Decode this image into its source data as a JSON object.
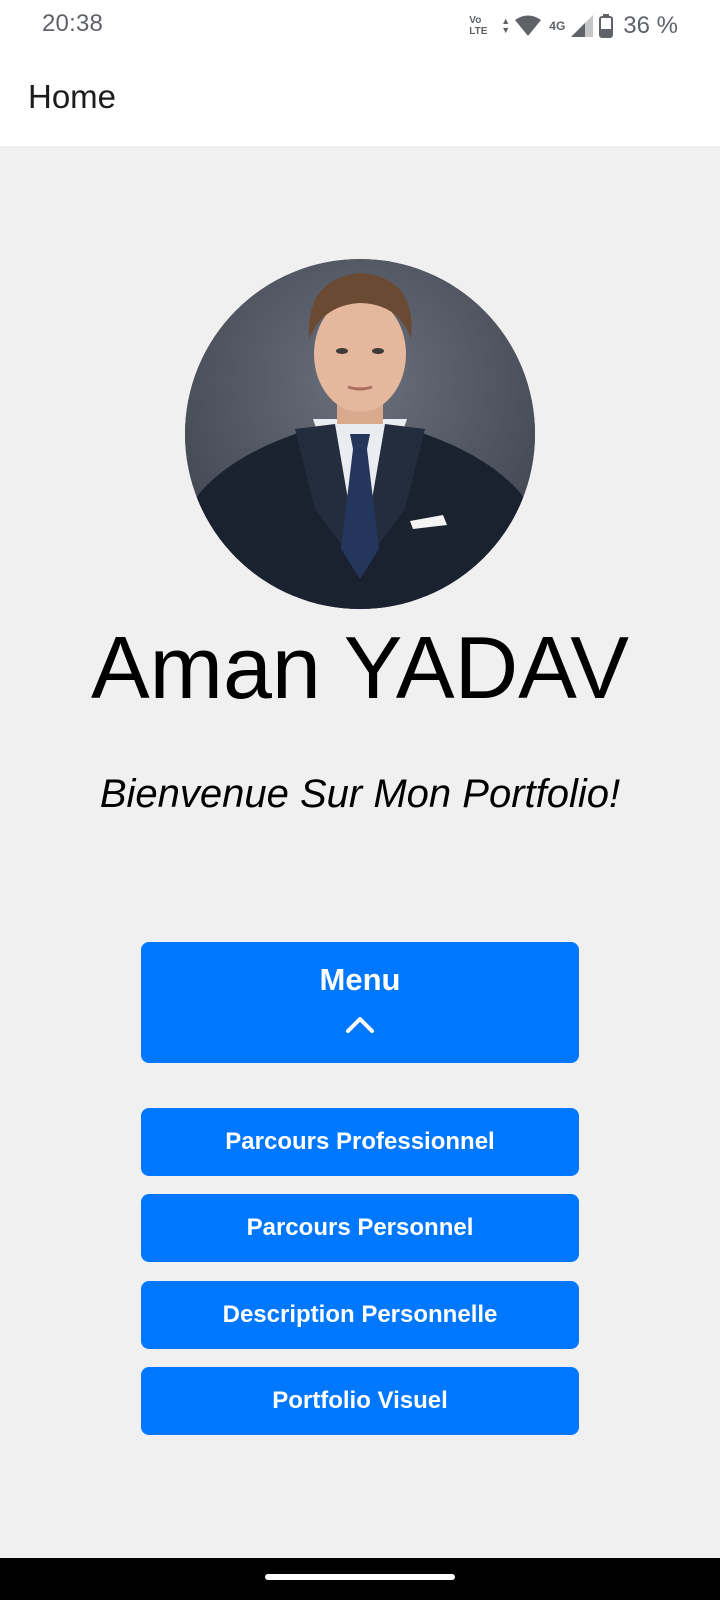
{
  "status_bar": {
    "time": "20:38",
    "volte_line1": "Vo",
    "volte_line2": "LTE",
    "network": "4G",
    "battery_percent": "36 %",
    "icons": [
      "volte-icon",
      "data-arrows-icon",
      "wifi-icon",
      "signal-icon",
      "battery-icon"
    ]
  },
  "app_bar": {
    "title": "Home"
  },
  "profile": {
    "avatar": "profile-photo",
    "name": "Aman YADAV",
    "tagline": "Bienvenue Sur Mon Portfolio!"
  },
  "menu": {
    "label": "Menu",
    "icon": "chevron-up-icon",
    "items": [
      {
        "label": "Parcours Professionnel"
      },
      {
        "label": "Parcours Personnel"
      },
      {
        "label": "Description Personnelle"
      },
      {
        "label": "Portfolio Visuel"
      }
    ]
  },
  "colors": {
    "accent": "#0077ff",
    "background": "#f0f0f0",
    "app_bar": "#ffffff",
    "nav_bar": "#000000"
  }
}
